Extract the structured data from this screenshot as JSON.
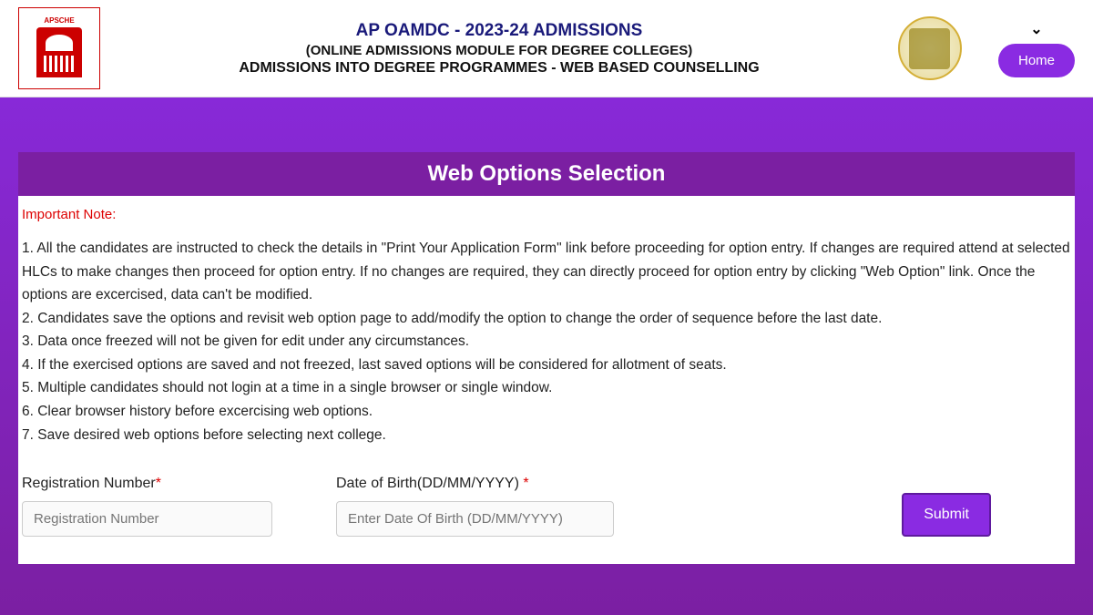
{
  "header": {
    "logo_left_text": "APSCHE",
    "title": "AP OAMDC - 2023-24 ADMISSIONS",
    "sub1": "(ONLINE ADMISSIONS MODULE FOR DEGREE COLLEGES)",
    "sub2": "ADMISSIONS INTO DEGREE PROGRAMMES - WEB BASED COUNSELLING",
    "home_label": "Home"
  },
  "section_title": "Web Options Selection",
  "important_note": "Important Note:",
  "notes": {
    "n1": "1. All the candidates are instructed to check the details in \"Print Your Application Form\" link before proceeding for option entry. If changes are required attend at selected HLCs to make changes then proceed for option entry. If no changes are required, they can directly proceed for option entry by clicking \"Web Option\" link. Once the options are excercised, data can't be modified.",
    "n2": "2. Candidates save the options and revisit web option page to add/modify the option to change the order of sequence before the last date.",
    "n3": "3. Data once freezed will not be given for edit under any circumstances.",
    "n4": "4. If the exercised options are saved and not freezed, last saved options will be considered for allotment of seats.",
    "n5": "5. Multiple candidates should not login at a time in a single browser or single window.",
    "n6": "6. Clear browser history before excercising web options.",
    "n7": "7. Save desired web options before selecting next college."
  },
  "form": {
    "reg_label": "Registration Number",
    "reg_placeholder": "Registration Number",
    "dob_label": "Date of Birth(DD/MM/YYYY) ",
    "dob_placeholder": "Enter Date Of Birth (DD/MM/YYYY)",
    "submit_label": "Submit"
  }
}
